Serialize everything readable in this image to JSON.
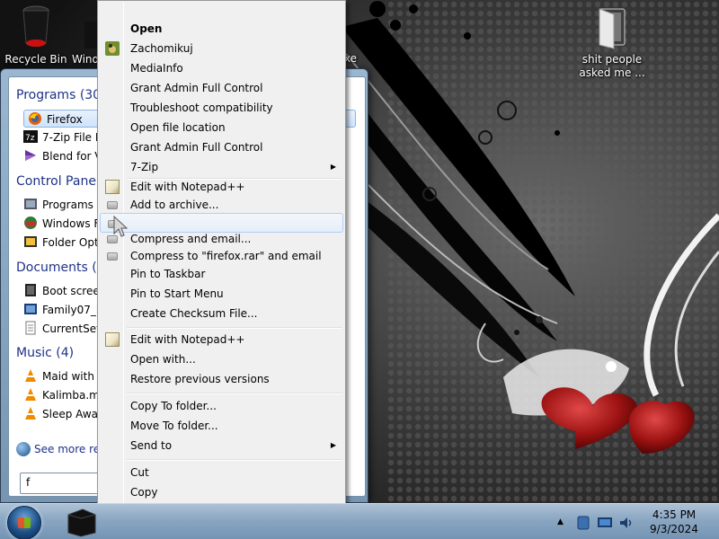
{
  "desktop": {
    "icons": [
      {
        "label": "Recycle Bin"
      },
      {
        "label": "Wind"
      },
      {
        "label": "shit people asked me ..."
      },
      {
        "label": "xe"
      }
    ]
  },
  "start_menu": {
    "groups": {
      "programs": "Programs (30)",
      "control_panel": "Control Panel",
      "documents": "Documents (8",
      "music": "Music (4)"
    },
    "programs": [
      "Firefox",
      "7-Zip File M",
      "Blend for Vi"
    ],
    "control_panel_items": [
      "Programs a",
      "Windows Fi",
      "Folder Opti"
    ],
    "documents_items": [
      "Boot screer",
      "Family07_b",
      "CurrentSett"
    ],
    "music_items": [
      "Maid with t",
      "Kalimba.mp",
      "Sleep Away"
    ],
    "see_more": "See more resu",
    "search_value": "f"
  },
  "context_menu": {
    "items": [
      {
        "label": "Open",
        "bold": true
      },
      {
        "label": "Zachomikuj",
        "icon": "zachomikuj-icon"
      },
      {
        "label": "MediaInfo"
      },
      {
        "label": "Grant Admin Full Control"
      },
      {
        "label": "Troubleshoot compatibility"
      },
      {
        "label": "Open file location"
      },
      {
        "label": "Grant Admin Full Control"
      },
      {
        "label": "7-Zip",
        "submenu": true
      },
      {
        "label": "Edit with Notepad++",
        "icon": "notepad-icon"
      },
      {
        "label": "Add to archive...",
        "icon": "archive-icon"
      },
      {
        "label": "",
        "icon": "archive-icon",
        "hover": true
      },
      {
        "label": "Compress and email...",
        "icon": "archive-icon"
      },
      {
        "label": "Compress to \"firefox.rar\" and email",
        "icon": "archive-icon"
      },
      {
        "label": "Pin to Taskbar"
      },
      {
        "label": "Pin to Start Menu"
      },
      {
        "label": "Create Checksum File..."
      },
      {
        "label": "Edit with Notepad++",
        "icon": "notepad-icon"
      },
      {
        "label": "Open with..."
      },
      {
        "label": "Restore previous versions"
      },
      {
        "label": "Copy To folder..."
      },
      {
        "label": "Move To folder..."
      },
      {
        "label": "Send to",
        "submenu": true
      },
      {
        "label": "Cut"
      },
      {
        "label": "Copy"
      }
    ],
    "more_arrow": "▼"
  },
  "taskbar": {
    "time": "4:35 PM",
    "date": "9/3/2024"
  },
  "colors": {
    "accent": "#1e3287",
    "menu_bg": "#f0f0f0",
    "hover_border": "#aecff7"
  }
}
